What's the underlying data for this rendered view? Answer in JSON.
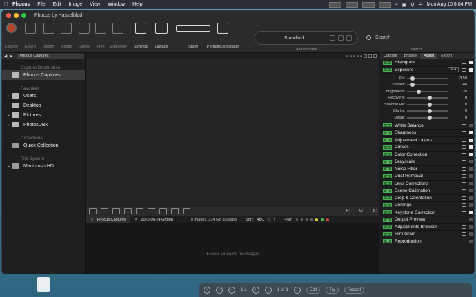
{
  "menubar": {
    "app": "Phocus",
    "items": [
      "File",
      "Edit",
      "Image",
      "View",
      "Window",
      "Help"
    ],
    "clock": "Mon Aug 10  8:04 PM"
  },
  "window": {
    "title": "Phocus by Hasselblad"
  },
  "toolbar": {
    "buttons": [
      "Capture",
      "Export",
      "Import",
      "Modify",
      "Delete",
      "Print",
      "Slideshow",
      "Settings",
      "Layouts",
      "Show",
      "Portrait/Landscape"
    ],
    "adjustments_value": "Standard",
    "adjustments_label": "Adjustments",
    "search_placeholder": "Search",
    "search_label": "Search"
  },
  "browser": {
    "path": "Phocus Captures",
    "sections": {
      "capture": "Capture Destination",
      "favorites": "Favorites",
      "collections": "Collections",
      "filesystem": "File System"
    },
    "capture_item": "Phocus Captures",
    "favorites": [
      "Users",
      "Desktop",
      "Pictures",
      "PhotosDBx"
    ],
    "collections": [
      "Quick Collection"
    ],
    "filesystem": [
      "Macintosh HD"
    ]
  },
  "viewer": {
    "rgb": [
      "R:",
      "G:",
      "B:"
    ],
    "tabs": [
      "Phocus Captures",
      "2026-06-24 Groton"
    ],
    "info": "0 images, 334 GB available",
    "sort_label": "Sort:",
    "sort_value": "ABC",
    "filter_label": "Filter:",
    "empty": "Folder contains no images"
  },
  "tools": {
    "tabs": [
      "Capture",
      "Browse",
      "Adjust",
      "Export"
    ],
    "active_tab": "Adjust",
    "histogram": "Histogram",
    "exposure": "Exposure",
    "exposure_version": "V 4",
    "sliders": [
      {
        "label": "EV:",
        "value": "-3.59",
        "level": 0.1
      },
      {
        "label": "Contrast:",
        "value": "-44",
        "level": 0.1
      },
      {
        "label": "Brightness:",
        "value": "-28",
        "level": 0.25
      },
      {
        "label": "Recovery:",
        "value": "0",
        "level": 0.55
      },
      {
        "label": "Shadow Fill:",
        "value": "0",
        "level": 0.55
      },
      {
        "label": "Clarity:",
        "value": "0",
        "level": 0.55
      },
      {
        "label": "Detail:",
        "value": "0",
        "level": 0.55
      }
    ],
    "items": [
      {
        "name": "White Balance",
        "checked": false
      },
      {
        "name": "Sharpness",
        "checked": true
      },
      {
        "name": "Adjustment Layers",
        "checked": true
      },
      {
        "name": "Curves",
        "checked": true
      },
      {
        "name": "Color Correction",
        "checked": true
      },
      {
        "name": "Grayscale",
        "checked": false
      },
      {
        "name": "Noise Filter",
        "checked": false
      },
      {
        "name": "Dust Removal",
        "checked": false
      },
      {
        "name": "Lens Corrections",
        "checked": false
      },
      {
        "name": "Scene Calibration",
        "checked": false
      },
      {
        "name": "Crop & Orientation",
        "checked": false
      },
      {
        "name": "Defringe",
        "checked": false
      },
      {
        "name": "Keystone Correction",
        "checked": true
      },
      {
        "name": "Output Preview",
        "checked": false
      },
      {
        "name": "Adjustments Browser",
        "checked": false
      },
      {
        "name": "Film Grain",
        "checked": false
      },
      {
        "name": "Reproduction",
        "checked": false
      }
    ]
  },
  "dock": {
    "counter_a": "1 c",
    "counter_b": "1 of 1",
    "buttons": [
      "Edit",
      "Try",
      "Record"
    ]
  }
}
